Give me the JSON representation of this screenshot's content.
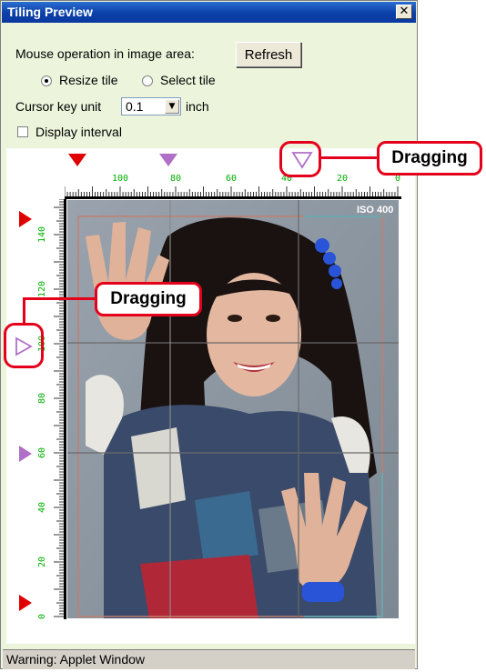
{
  "window": {
    "title": "Tiling Preview",
    "close_glyph": "✕"
  },
  "controls": {
    "mouse_label": "Mouse operation in image area:",
    "refresh_label": "Refresh",
    "radio_resize_label": "Resize tile",
    "radio_select_label": "Select tile",
    "radio_selected": "Resize tile",
    "cursor_label": "Cursor key unit",
    "cursor_value": "0.1",
    "cursor_unit": "inch",
    "display_interval_label": "Display interval",
    "display_interval_checked": false
  },
  "rulers": {
    "top_labels": [
      "100",
      "80",
      "60",
      "40",
      "20",
      "0"
    ],
    "left_labels": [
      "140",
      "120",
      "100",
      "80",
      "60",
      "40",
      "20",
      "0"
    ],
    "label_color": "#00b000"
  },
  "photo": {
    "iso_label": "ISO 400"
  },
  "markers": {
    "red": "#e00000",
    "purple": "#b070c8"
  },
  "callouts": {
    "top": "Dragging",
    "left": "Dragging"
  },
  "status": {
    "text": "Warning: Applet Window"
  }
}
